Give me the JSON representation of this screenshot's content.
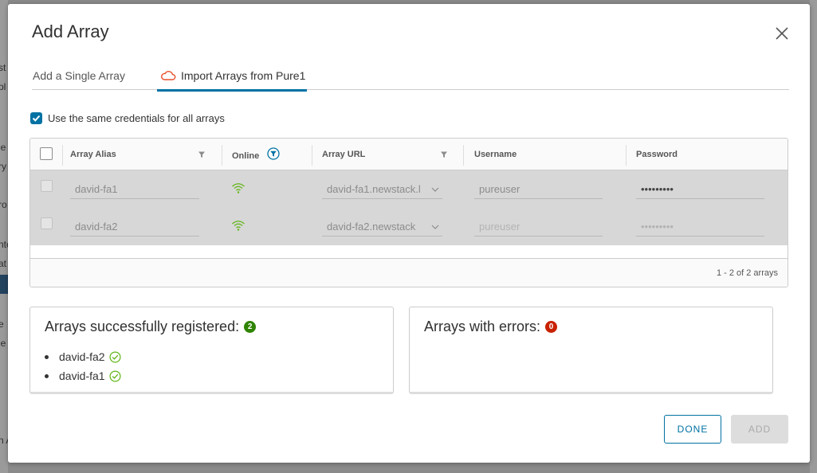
{
  "background": {
    "fragments": [
      "st",
      "pl",
      "ie",
      "ry",
      "ro",
      "nte",
      "at",
      "e",
      "ie",
      "n A"
    ]
  },
  "dialog": {
    "title": "Add Array",
    "tabs": [
      {
        "label": "Add a Single Array",
        "active": false
      },
      {
        "label": "Import Arrays from Pure1",
        "active": true
      }
    ],
    "same_credentials_label": "Use the same credentials for all arrays",
    "same_credentials_checked": true
  },
  "grid": {
    "columns": [
      "Array Alias",
      "Online",
      "Array URL",
      "Username",
      "Password"
    ],
    "rows": [
      {
        "alias": "david-fa1",
        "online": true,
        "url": "david-fa1.newstack.l",
        "username": "pureuser",
        "password": "•••••••••"
      },
      {
        "alias": "david-fa2",
        "online": true,
        "url": "david-fa2.newstack",
        "username": "pureuser",
        "password": "•••••••••"
      }
    ],
    "footer": "1 - 2 of 2 arrays"
  },
  "results": {
    "success_title": "Arrays successfully registered:",
    "success_count": "2",
    "success_items": [
      "david-fa2",
      "david-fa1"
    ],
    "error_title": "Arrays with errors:",
    "error_count": "0"
  },
  "buttons": {
    "done": "DONE",
    "add": "ADD"
  },
  "colors": {
    "accent": "#0072a3",
    "success": "#2f8400",
    "error": "#c92100",
    "cloud_icon": "#e8502a",
    "wifi_icon": "#60b515"
  }
}
